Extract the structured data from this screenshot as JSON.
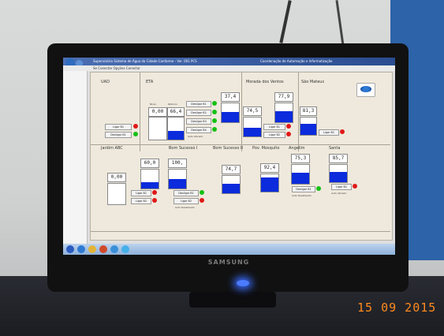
{
  "window": {
    "title": "Supervisório Sistema de Água da Cidade Conforme - Ver. 001 PCS",
    "title_right": "Coordenação de Automação e Informatização",
    "menu": "Se Conectar   Opções Conectar"
  },
  "stations": {
    "uad": {
      "label": "UAD",
      "btn_ligar": "Ligar B1",
      "btn_desligar": "Desligar B1"
    },
    "eta": {
      "label": "ETA",
      "small_a": "Nível",
      "small_b": "Retorno",
      "value_a": "0,00",
      "value_b": "66,4",
      "btn1": "Desligar B1",
      "btn2": "Desligar B2",
      "btn3": "Desligar B3",
      "btn4": "Desligar B4",
      "auto": "Auto Ativado",
      "level": 0.4
    },
    "tank_37": {
      "value": "37,4",
      "level": 0.55
    },
    "morada": {
      "label": "Morada dos Ventos",
      "value_a": "74,5",
      "value_b": "77,9",
      "btn1": "Ligar B1",
      "btn2": "Ligar B2",
      "level_a": 0.45,
      "level_b": 0.6
    },
    "sao_mateus": {
      "label": "São Mateus",
      "value": "81,3",
      "btn": "Ligar B1",
      "level": 0.65
    },
    "jardim": {
      "label": "Jardim ABC",
      "value_a": "0,00",
      "value_b": "60,0",
      "btn1": "Ligar B1",
      "btn2": "Ligar B2",
      "level_b": 0.35
    },
    "bom_sucesso_1": {
      "label": "Bom Sucesso I",
      "value": "100,",
      "btn1": "Desligar B1",
      "btn2": "Ligar B2",
      "auto": "Auto Desativado",
      "level": 0.5
    },
    "bom_sucesso_2": {
      "label": "Bom Sucesso II",
      "value": "74,7",
      "level": 0.55
    },
    "pov_mosquito": {
      "label": "Pov. Mosquito",
      "value": "92,4",
      "level": 0.8
    },
    "angelim": {
      "label": "Angelim",
      "value": "75,3",
      "btn": "Desligar B1",
      "auto": "Auto Desativado",
      "level": 0.6
    },
    "santa": {
      "label": "Santa",
      "value": "85,7",
      "btn": "Ligar B1",
      "auto": "Auto Ativado",
      "level": 0.6
    }
  },
  "monitor": {
    "brand": "SAMSUNG"
  },
  "photo": {
    "date_stamp": "15 09 2015"
  },
  "colors": {
    "tank_fill": "#0b2bdc",
    "led_red": "#e01818",
    "led_green": "#16c016",
    "date": "#ff8a1f"
  }
}
